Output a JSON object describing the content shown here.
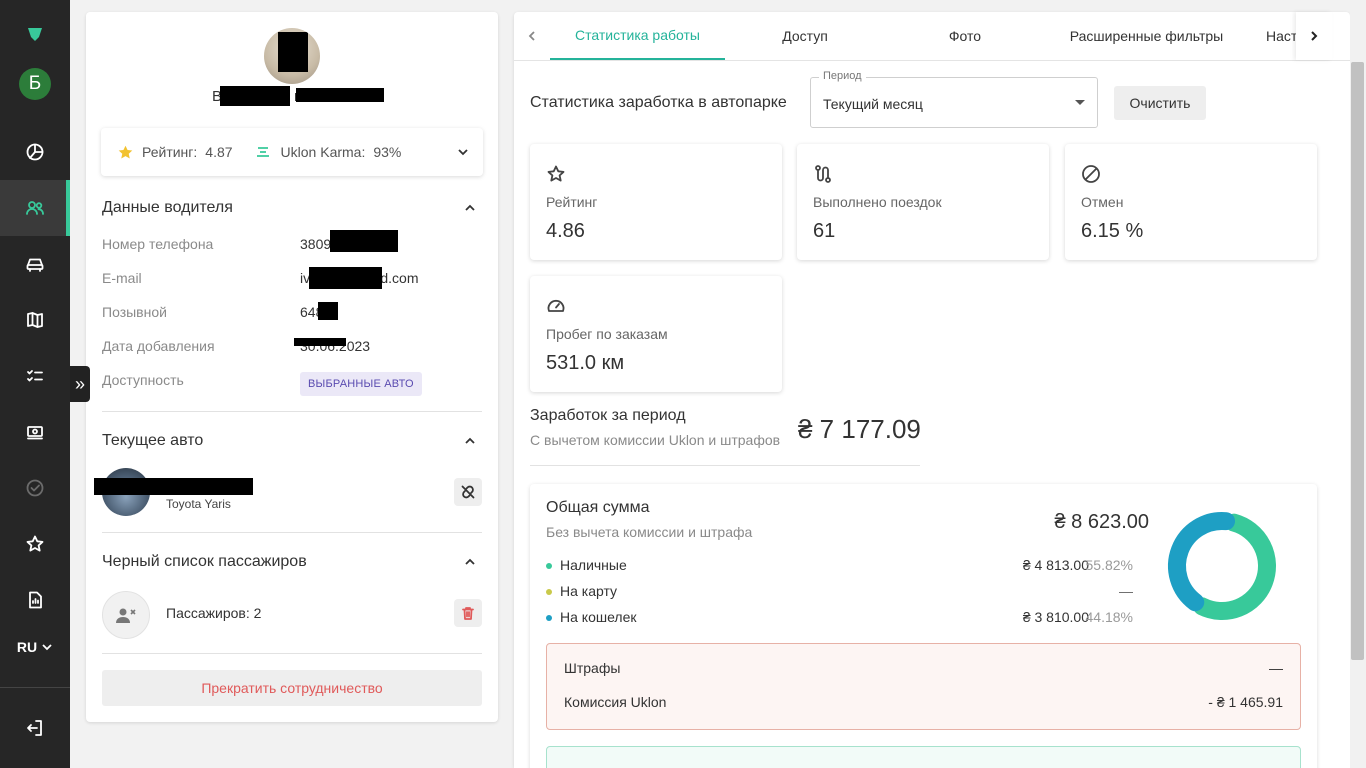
{
  "sidebar": {
    "avatar_letter": "Б",
    "language": "RU",
    "icons": [
      "logo-icon",
      "dashboard-icon",
      "drivers-icon",
      "car-icon",
      "map-icon",
      "tasks-icon",
      "payments-icon",
      "verified-icon",
      "star-icon",
      "report-icon",
      "logout-icon"
    ]
  },
  "profile": {
    "name_partial_a": "В",
    "name_partial_b": "в",
    "rating_label": "Рейтинг:",
    "rating_value": "4.87",
    "karma_label": "Uklon Karma:",
    "karma_value": "93%"
  },
  "driver_data": {
    "title": "Данные водителя",
    "fields": [
      {
        "label": "Номер телефона",
        "value": "3809"
      },
      {
        "label": "E-mail",
        "value": "iv                       d87@icloud.com"
      },
      {
        "label": "Позывной",
        "value": "648    7"
      },
      {
        "label": "Дата добавления",
        "value": "30.06.2023"
      },
      {
        "label": "Доступность",
        "badge": "ВЫБРАННЫЕ АВТО"
      }
    ]
  },
  "current_car": {
    "title": "Текущее авто",
    "model": "Toyota Yaris"
  },
  "blacklist": {
    "title": "Черный список пассажиров",
    "passengers": "Пассажиров: 2"
  },
  "stop_button": "Прекратить сотрудничество",
  "tabs": [
    "Статистика работы",
    "Доступ",
    "Фото",
    "Расширенные фильтры",
    "Настройки"
  ],
  "stats": {
    "title": "Статистика заработка в автопарке",
    "period_label": "Период",
    "period_value": "Текущий месяц",
    "clear_button": "Очистить",
    "kpis": [
      {
        "icon": "star-outline-icon",
        "label": "Рейтинг",
        "value": "4.86"
      },
      {
        "icon": "route-icon",
        "label": "Выполнено поездок",
        "value": "61"
      },
      {
        "icon": "cancel-icon",
        "label": "Отмен",
        "value": "6.15 %"
      },
      {
        "icon": "speedometer-icon",
        "label": "Пробег по заказам",
        "value": "531.0 км"
      }
    ]
  },
  "earnings": {
    "title": "Заработок за период",
    "subtitle": "С вычетом комиссии Uklon и штрафов",
    "total": "₴ 7 177.09"
  },
  "summary": {
    "title": "Общая сумма",
    "subtitle": "Без вычета комиссии и штрафа",
    "total": "₴ 8 623.00",
    "rows": [
      {
        "label": "Наличные",
        "amount": "₴ 4 813.00",
        "percent": "55.82%",
        "color": "#38c99a"
      },
      {
        "label": "На карту",
        "amount": "",
        "percent": "",
        "dash": "—",
        "color": "#c9c94a"
      },
      {
        "label": "На кошелек",
        "amount": "₴ 3 810.00",
        "percent": "44.18%",
        "color": "#1e9fc4"
      }
    ],
    "donut_fractions": [
      0.5582,
      0.4418
    ],
    "donut_colors": [
      "#38c99a",
      "#1e9fc4"
    ],
    "fees": [
      {
        "label": "Штрафы",
        "value": "—"
      },
      {
        "label": "Комиссия Uklon",
        "value": "- ₴ 1 465.91"
      }
    ]
  }
}
